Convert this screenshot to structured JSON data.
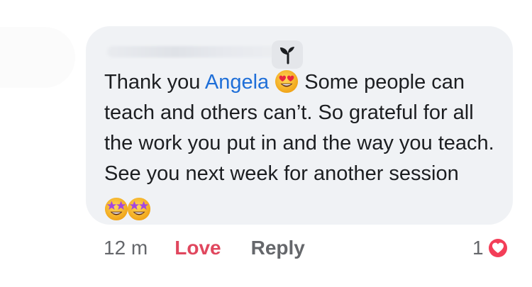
{
  "comment": {
    "author_name": "",
    "text_before_mention": "Thank you ",
    "mention": "Angela",
    "text_after_emoji": " Some people can teach and others can’t. So grateful for all the work you put in and the way you teach. See you next week for another session ",
    "emojis": [
      "heart-eyes-emoji",
      "star-struck-emoji",
      "star-struck-emoji"
    ]
  },
  "actions": {
    "time": "12 m",
    "love_label": "Love",
    "reply_label": "Reply"
  },
  "reactions": {
    "count": "1",
    "type": "love-reaction-icon"
  },
  "colors": {
    "bubble_bg": "#f0f2f5",
    "mention": "#1f6fd8",
    "love": "#e0475e",
    "meta_text": "#65676b"
  }
}
